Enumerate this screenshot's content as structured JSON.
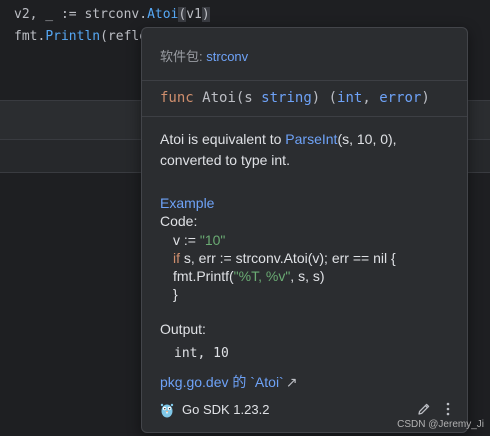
{
  "editor": {
    "line1": {
      "prefix": "v2, _ := ",
      "pkg": "strconv.",
      "func": "Atoi",
      "paren_open": "(",
      "arg": "v1",
      "paren_close": ")"
    },
    "line2": {
      "pkg": "fmt.",
      "func": "Println",
      "rest": "(reflec"
    }
  },
  "popup": {
    "package_label": "软件包:",
    "package_name": "strconv",
    "signature": {
      "kw_func": "func",
      "name": "Atoi(s ",
      "param_type": "string",
      "mid": ") (",
      "ret1": "int",
      "comma": ", ",
      "ret2": "error",
      "close": ")"
    },
    "description": {
      "part1": "Atoi is equivalent to ",
      "link": "ParseInt",
      "part2": "(s, 10, 0), converted to type int."
    },
    "example": {
      "title": "Example",
      "code_label": "Code:",
      "line1_a": "v := ",
      "line1_str": "\"10\"",
      "line2_kw": "if",
      "line2_rest": " s, err := strconv.Atoi(v); err == nil {",
      "line3_a": "fmt.Printf(",
      "line3_str": "\"%T, %v\"",
      "line3_b": ", s, s)",
      "line4": "}"
    },
    "output": {
      "label": "Output:",
      "value": "int, 10"
    },
    "external_link": {
      "text": "pkg.go.dev 的 `Atoi`",
      "arrow": "↗"
    },
    "footer": {
      "sdk_label": "Go SDK 1.23.2"
    }
  },
  "watermark": "CSDN @Jeremy_Ji",
  "icons": {
    "sdk": "go-gopher-icon",
    "edit": "pencil-icon",
    "more": "more-vertical-icon"
  }
}
